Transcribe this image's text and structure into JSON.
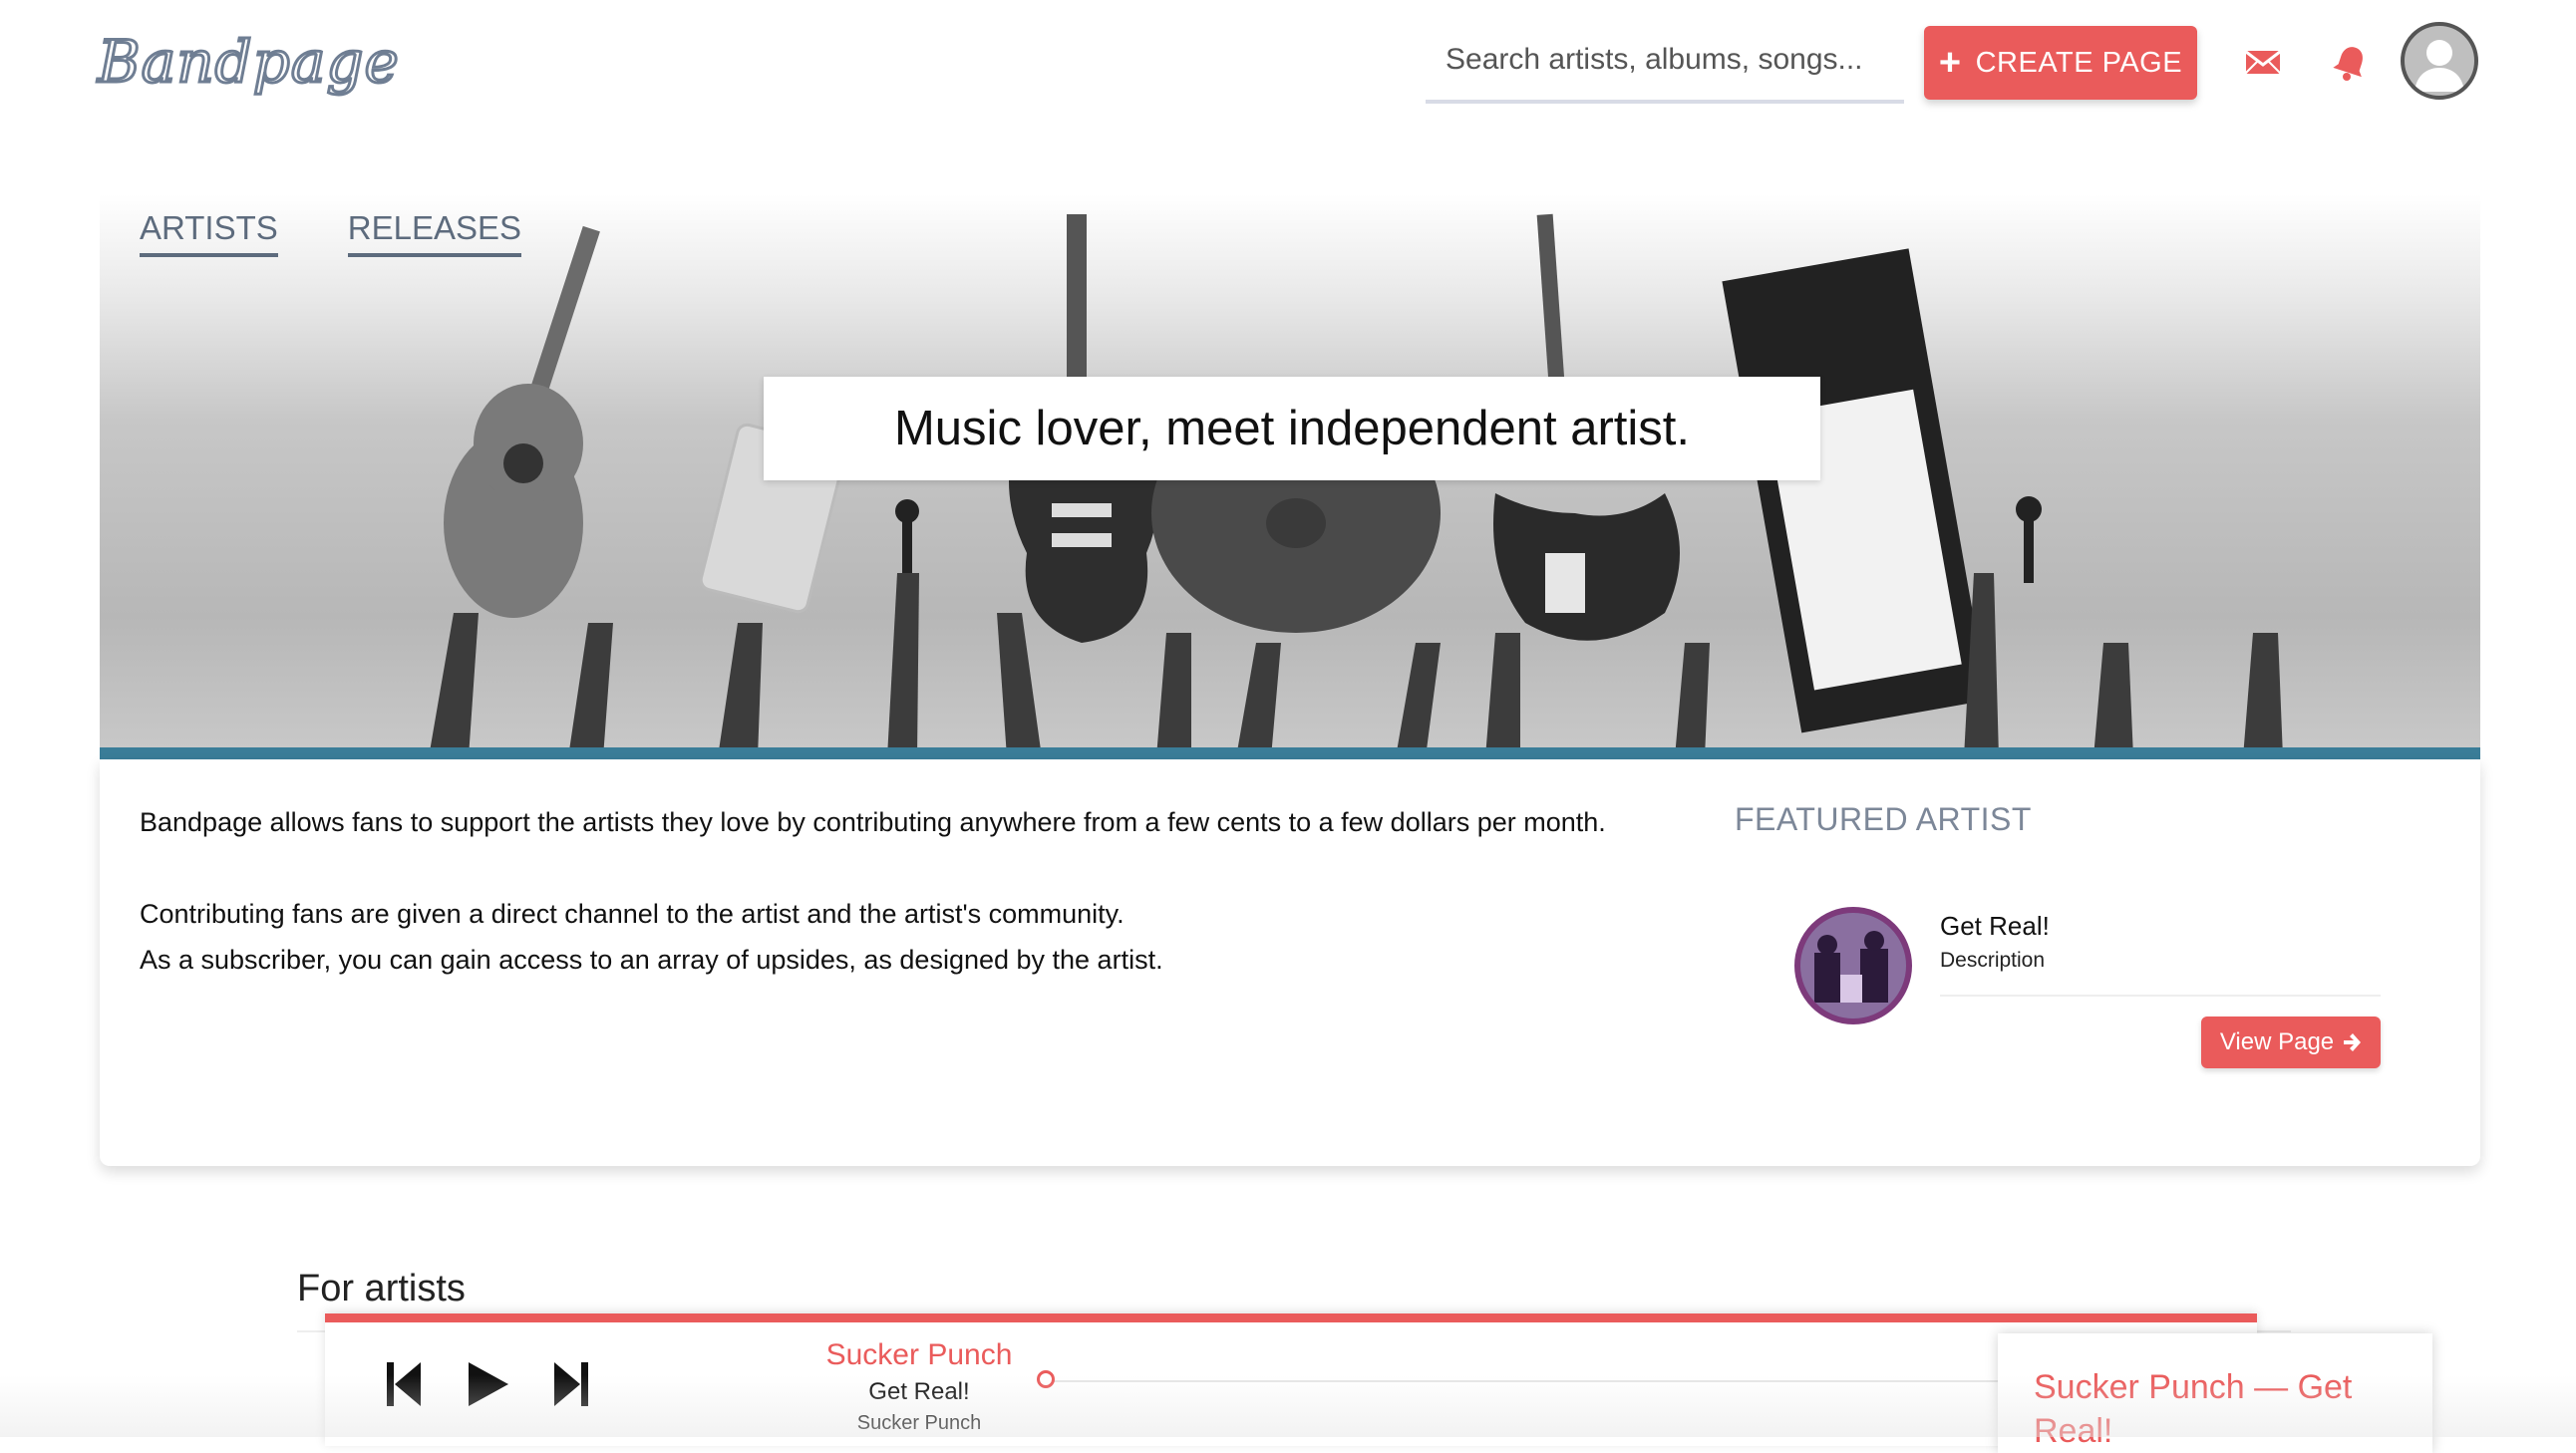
{
  "header": {
    "logo_text": "Bandpage",
    "search_placeholder": "Search artists, albums, songs...",
    "create_button_label": "CREATE PAGE",
    "icons": [
      "mail-icon",
      "bell-icon",
      "user-avatar-icon"
    ],
    "accent_color": "#ea5b5b"
  },
  "hero": {
    "tabs": [
      {
        "label": "ARTISTS"
      },
      {
        "label": "RELEASES"
      }
    ],
    "tagline": "Music lover, meet independent artist.",
    "band_color": "#3a7d98"
  },
  "info": {
    "paragraph_1": "Bandpage allows fans to support the artists they love by contributing anywhere from a few cents to a few dollars per month.",
    "paragraph_2_line_1": "Contributing fans are given a direct channel to the artist and the artist's community.",
    "paragraph_2_line_2": "As a subscriber, you can gain access to an array of upsides, as designed by the artist.",
    "featured": {
      "heading": "FEATURED ARTIST",
      "name": "Get Real!",
      "description": "Description",
      "button_label": "View Page"
    }
  },
  "section": {
    "for_artists_heading": "For artists"
  },
  "player": {
    "title": "Sucker Punch",
    "album": "Get Real!",
    "artist": "Sucker Punch",
    "progress_fraction": 0.0,
    "now_playing_text": "Sucker Punch — Get Real!"
  }
}
